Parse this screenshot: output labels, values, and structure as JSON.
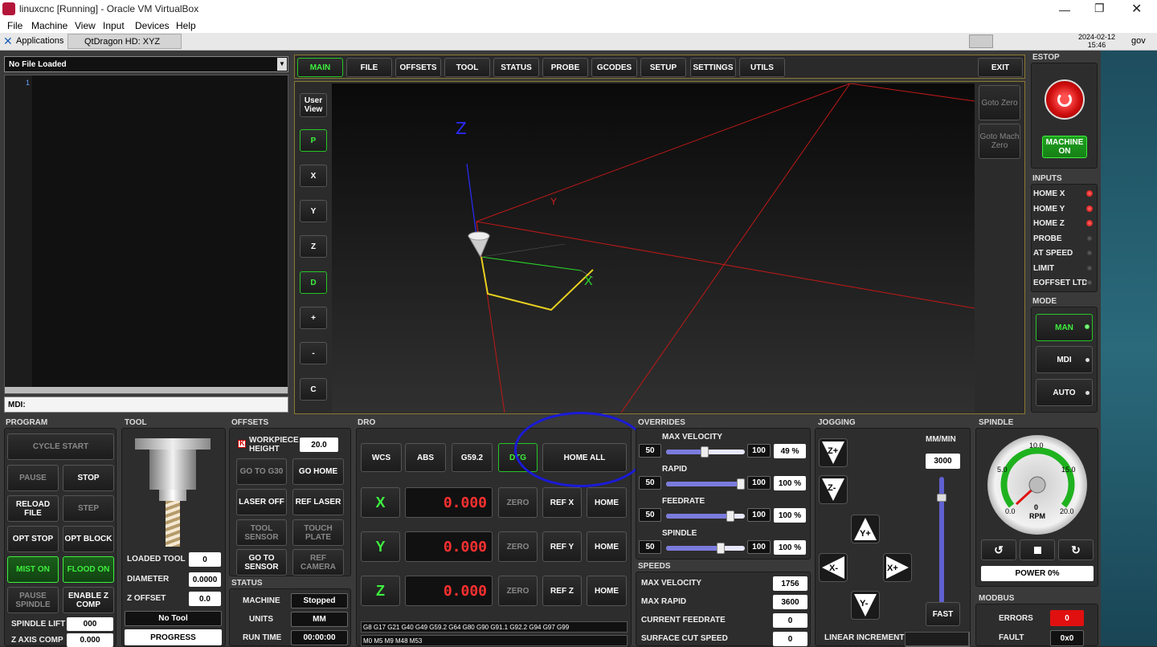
{
  "host": {
    "window_title": "linuxcnc [Running] - Oracle VM VirtualBox",
    "menu": [
      "File",
      "Machine",
      "View",
      "Input",
      "Devices",
      "Help"
    ],
    "taskbar_apps": "Applications",
    "taskbar_window": "QtDragon HD: XYZ",
    "clock_date": "2024-02-12",
    "clock_time": "15:46",
    "user": "gov"
  },
  "file": {
    "loaded": "No File Loaded",
    "line_number": "1",
    "mdi_label": "MDI:"
  },
  "tabs": [
    "MAIN",
    "FILE",
    "OFFSETS",
    "TOOL",
    "STATUS",
    "PROBE",
    "GCODES",
    "SETUP",
    "SETTINGS",
    "UTILS"
  ],
  "exit_label": "EXIT",
  "view_buttons": [
    "User View",
    "P",
    "X",
    "Y",
    "Z",
    "D",
    "+",
    "-",
    "C"
  ],
  "goto": {
    "zero": "Goto Zero",
    "mach_zero": "Goto Mach Zero"
  },
  "viewport_axes": {
    "z": "Z",
    "y": "Y",
    "x": "X"
  },
  "estop": {
    "title": "ESTOP",
    "machine_on": "MACHINE ON"
  },
  "inputs": {
    "title": "INPUTS",
    "items": [
      {
        "label": "HOME X",
        "state": "red"
      },
      {
        "label": "HOME Y",
        "state": "red"
      },
      {
        "label": "HOME Z",
        "state": "red"
      },
      {
        "label": "PROBE",
        "state": "off"
      },
      {
        "label": "AT SPEED",
        "state": "off"
      },
      {
        "label": "LIMIT",
        "state": "off"
      },
      {
        "label": "EOFFSET LTD",
        "state": "off"
      }
    ]
  },
  "mode": {
    "title": "MODE",
    "items": [
      "MAN",
      "MDI",
      "AUTO"
    ]
  },
  "program": {
    "title": "PROGRAM",
    "cycle_start": "CYCLE START",
    "pause": "PAUSE",
    "stop": "STOP",
    "reload": "RELOAD FILE",
    "step": "STEP",
    "opt_stop": "OPT STOP",
    "opt_block": "OPT BLOCK",
    "mist": "MIST ON",
    "flood": "FLOOD ON",
    "pause_spindle": "PAUSE SPINDLE",
    "enable_zcomp": "ENABLE Z COMP",
    "spindle_lift_label": "SPINDLE LIFT",
    "spindle_lift": "000",
    "z_axis_comp_label": "Z AXIS COMP",
    "z_axis_comp": "0.000"
  },
  "tool": {
    "title": "TOOL",
    "loaded_tool_label": "LOADED TOOL",
    "loaded_tool": "0",
    "diameter_label": "DIAMETER",
    "diameter": "0.0000",
    "z_offset_label": "Z OFFSET",
    "z_offset": "0.0",
    "tool_name": "No Tool",
    "progress": "PROGRESS"
  },
  "offsets": {
    "title": "OFFSETS",
    "workpiece_height_label": "WORKPIECE HEIGHT",
    "workpiece_height": "20.0",
    "goto_g30": "GO TO G30",
    "go_home": "GO HOME",
    "laser_off": "LASER OFF",
    "ref_laser": "REF LASER",
    "tool_sensor": "TOOL SENSOR",
    "touch_plate": "TOUCH PLATE",
    "goto_sensor": "GO TO SENSOR",
    "ref_camera": "REF CAMERA"
  },
  "status": {
    "title": "STATUS",
    "machine_label": "MACHINE",
    "machine": "Stopped",
    "units_label": "UNITS",
    "units": "MM",
    "run_time_label": "RUN TIME",
    "run_time": "00:00:00"
  },
  "dro": {
    "title": "DRO",
    "wcs": "WCS",
    "abs": "ABS",
    "g59": "G59.2",
    "dtg": "DTG",
    "home_all": "HOME ALL",
    "axes": [
      {
        "axis": "X",
        "value": "0.000",
        "zero": "ZERO",
        "ref": "REF X",
        "home": "HOME"
      },
      {
        "axis": "Y",
        "value": "0.000",
        "zero": "ZERO",
        "ref": "REF Y",
        "home": "HOME"
      },
      {
        "axis": "Z",
        "value": "0.000",
        "zero": "ZERO",
        "ref": "REF Z",
        "home": "HOME"
      }
    ],
    "gcodes": "G8 G17 G21 G40 G49 G59.2 G64 G80 G90 G91.1 G92.2 G94 G97 G99",
    "mcodes": "M0 M5 M9 M48 M53"
  },
  "overrides": {
    "title": "OVERRIDES",
    "items": [
      {
        "label": "MAX VELOCITY",
        "min": "50",
        "max": "100",
        "value": "49 %",
        "fraction": 0.49
      },
      {
        "label": "RAPID",
        "min": "50",
        "max": "100",
        "value": "100 %",
        "fraction": 1.0
      },
      {
        "label": "FEEDRATE",
        "min": "50",
        "max": "100",
        "value": "100 %",
        "fraction": 0.85
      },
      {
        "label": "SPINDLE",
        "min": "50",
        "max": "100",
        "value": "100 %",
        "fraction": 0.7
      }
    ]
  },
  "speeds": {
    "title": "SPEEDS",
    "items": [
      {
        "label": "MAX VELOCITY",
        "value": "1756"
      },
      {
        "label": "MAX RAPID",
        "value": "3600"
      },
      {
        "label": "CURRENT FEEDRATE",
        "value": "0"
      },
      {
        "label": "SURFACE CUT SPEED",
        "value": "0"
      }
    ]
  },
  "jogging": {
    "title": "JOGGING",
    "units": "MM/MIN",
    "rate": "3000",
    "fast": "FAST",
    "linear_increment": "LINEAR INCREMENT",
    "buttons": [
      "Z+",
      "Z-",
      "Y+",
      "X-",
      "X+",
      "Y-"
    ]
  },
  "spindle": {
    "title": "SPINDLE",
    "gauge_labels": [
      "10.0",
      "5.0",
      "15.0",
      "0.0",
      "20.0"
    ],
    "gauge_value": "0",
    "gauge_unit": "RPM",
    "power": "POWER 0%"
  },
  "modbus": {
    "title": "MODBUS",
    "errors_label": "ERRORS",
    "errors": "0",
    "fault_label": "FAULT",
    "fault": "0x0"
  },
  "colors": {
    "accent_green": "#3ef03e",
    "dro_red": "#ff3030",
    "annotation_blue": "#1a1ad8"
  }
}
